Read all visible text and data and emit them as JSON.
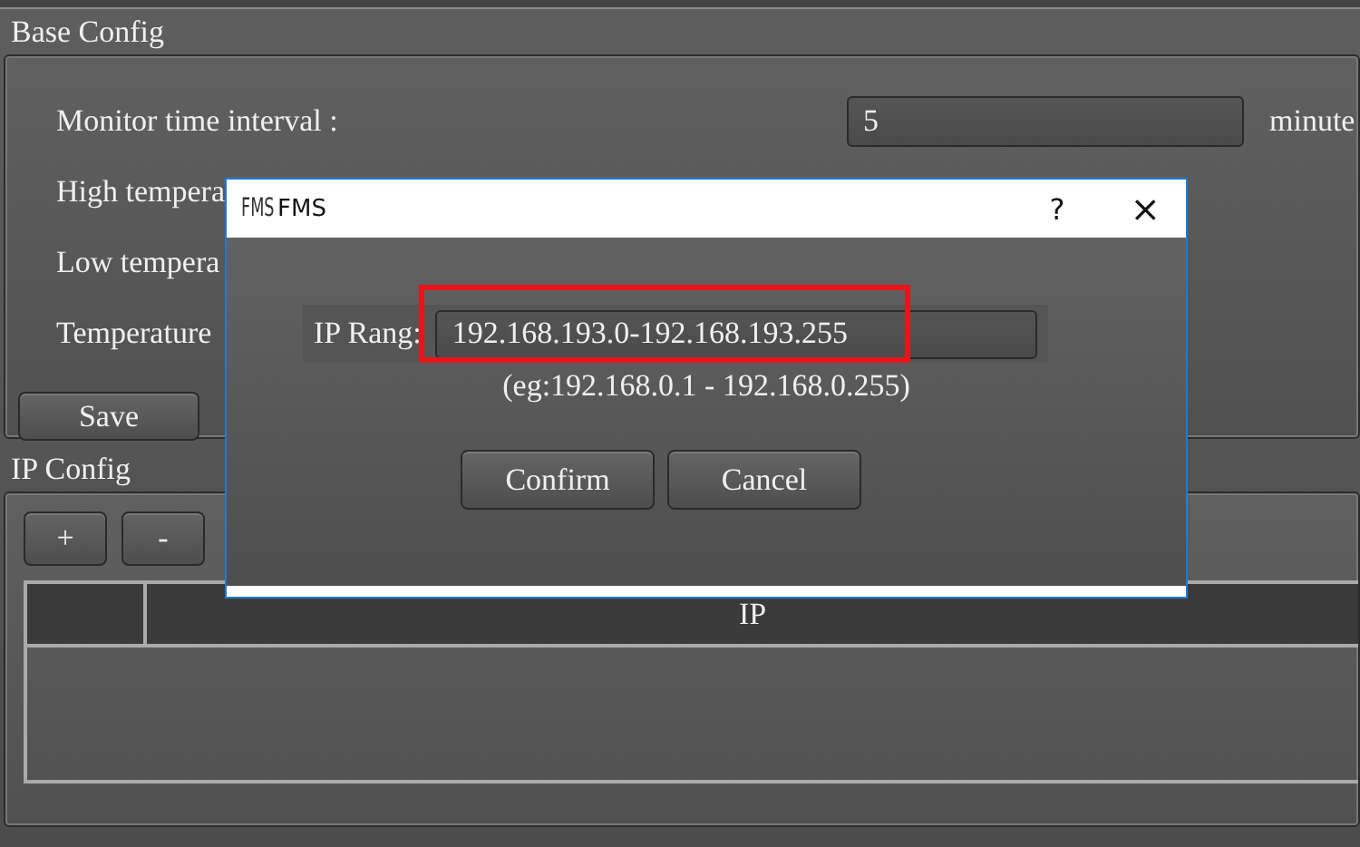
{
  "base_config": {
    "title": "Base Config",
    "rows": [
      {
        "label": "Monitor time interval :",
        "value": "5",
        "unit": "minute"
      },
      {
        "label": "High tempera"
      },
      {
        "label": "Low tempera"
      },
      {
        "label": "Temperature"
      }
    ],
    "save_button": "Save"
  },
  "ip_config": {
    "title": "IP Config",
    "buttons": [
      "+",
      "-"
    ],
    "table": {
      "columns": [
        "",
        "IP"
      ]
    }
  },
  "dialog": {
    "logo": "FMS",
    "title": "FMS",
    "help": "?",
    "close": "×",
    "field_label": "IP Rang:",
    "field_value": "192.168.193.0-192.168.193.255",
    "highlighted": true,
    "hint": "(eg:192.168.0.1 - 192.168.0.255)",
    "buttons": [
      "Confirm",
      "Cancel"
    ]
  }
}
